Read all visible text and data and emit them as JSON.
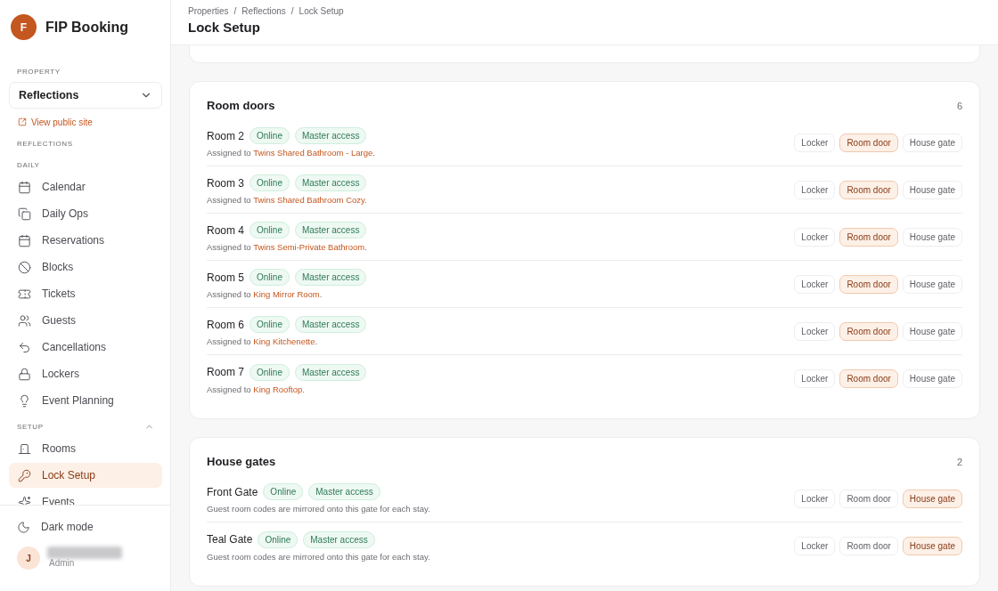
{
  "brand": {
    "initial": "F",
    "name": "FIP Booking"
  },
  "property": {
    "label": "PROPERTY",
    "value": "Reflections",
    "link": "View public site"
  },
  "sections": [
    {
      "title": "REFLECTIONS"
    },
    {
      "title": "DAILY",
      "items": [
        {
          "kind": "calendar",
          "label": "Calendar",
          "selected": false
        },
        {
          "kind": "copies",
          "label": "Daily Ops",
          "selected": false
        },
        {
          "kind": "calendar",
          "label": "Reservations",
          "selected": false
        },
        {
          "kind": "ban",
          "label": "Blocks",
          "selected": false
        },
        {
          "kind": "ticket",
          "label": "Tickets",
          "selected": false
        },
        {
          "kind": "users",
          "label": "Guests",
          "selected": false
        },
        {
          "kind": "undo",
          "label": "Cancellations",
          "selected": false
        },
        {
          "kind": "lock",
          "label": "Lockers",
          "selected": false
        },
        {
          "kind": "bulb",
          "label": "Event Planning",
          "selected": false
        }
      ]
    },
    {
      "title": "SETUP",
      "expanded": true,
      "items": [
        {
          "kind": "door",
          "label": "Rooms",
          "selected": false
        },
        {
          "kind": "key",
          "label": "Lock Setup",
          "selected": true
        },
        {
          "kind": "sparkles",
          "label": "Events",
          "selected": false
        }
      ]
    }
  ],
  "footer": {
    "dark_mode": "Dark mode",
    "user": {
      "initial": "J",
      "role": "Admin"
    }
  },
  "breadcrumb": {
    "separator": "/",
    "items": [
      "Properties",
      "Reflections",
      "Lock Setup"
    ]
  },
  "page_title": "Lock Setup",
  "groups": [
    {
      "title": "Room doors",
      "count": "6",
      "rows": [
        {
          "name": "Room 2",
          "badges": [
            "Online",
            "Master access"
          ],
          "prefix": "Assigned to",
          "target": "Twins Shared Bathroom - Large",
          "suffix": ".",
          "types": [
            {
              "label": "Locker",
              "selected": false
            },
            {
              "label": "Room door",
              "selected": true
            },
            {
              "label": "House gate",
              "selected": false
            }
          ]
        },
        {
          "name": "Room 3",
          "badges": [
            "Online",
            "Master access"
          ],
          "prefix": "Assigned to",
          "target": "Twins Shared Bathroom Cozy",
          "suffix": ".",
          "types": [
            {
              "label": "Locker",
              "selected": false
            },
            {
              "label": "Room door",
              "selected": true
            },
            {
              "label": "House gate",
              "selected": false
            }
          ]
        },
        {
          "name": "Room 4",
          "badges": [
            "Online",
            "Master access"
          ],
          "prefix": "Assigned to",
          "target": "Twins Semi-Private Bathroom",
          "suffix": ".",
          "types": [
            {
              "label": "Locker",
              "selected": false
            },
            {
              "label": "Room door",
              "selected": true
            },
            {
              "label": "House gate",
              "selected": false
            }
          ]
        },
        {
          "name": "Room 5",
          "badges": [
            "Online",
            "Master access"
          ],
          "prefix": "Assigned to",
          "target": "King Mirror Room",
          "suffix": ".",
          "types": [
            {
              "label": "Locker",
              "selected": false
            },
            {
              "label": "Room door",
              "selected": true
            },
            {
              "label": "House gate",
              "selected": false
            }
          ]
        },
        {
          "name": "Room 6",
          "badges": [
            "Online",
            "Master access"
          ],
          "prefix": "Assigned to",
          "target": "King Kitchenette",
          "suffix": ".",
          "types": [
            {
              "label": "Locker",
              "selected": false
            },
            {
              "label": "Room door",
              "selected": true
            },
            {
              "label": "House gate",
              "selected": false
            }
          ]
        },
        {
          "name": "Room 7",
          "badges": [
            "Online",
            "Master access"
          ],
          "prefix": "Assigned to",
          "target": "King Rooftop",
          "suffix": ".",
          "types": [
            {
              "label": "Locker",
              "selected": false
            },
            {
              "label": "Room door",
              "selected": true
            },
            {
              "label": "House gate",
              "selected": false
            }
          ]
        }
      ]
    },
    {
      "title": "House gates",
      "count": "2",
      "rows": [
        {
          "name": "Front Gate",
          "badges": [
            "Online",
            "Master access"
          ],
          "note": "Guest room codes are mirrored onto this gate for each stay.",
          "types": [
            {
              "label": "Locker",
              "selected": false
            },
            {
              "label": "Room door",
              "selected": false
            },
            {
              "label": "House gate",
              "selected": true
            }
          ]
        },
        {
          "name": "Teal Gate",
          "badges": [
            "Online",
            "Master access"
          ],
          "note": "Guest room codes are mirrored onto this gate for each stay.",
          "types": [
            {
              "label": "Locker",
              "selected": false
            },
            {
              "label": "Room door",
              "selected": false
            },
            {
              "label": "House gate",
              "selected": true
            }
          ]
        }
      ]
    }
  ]
}
